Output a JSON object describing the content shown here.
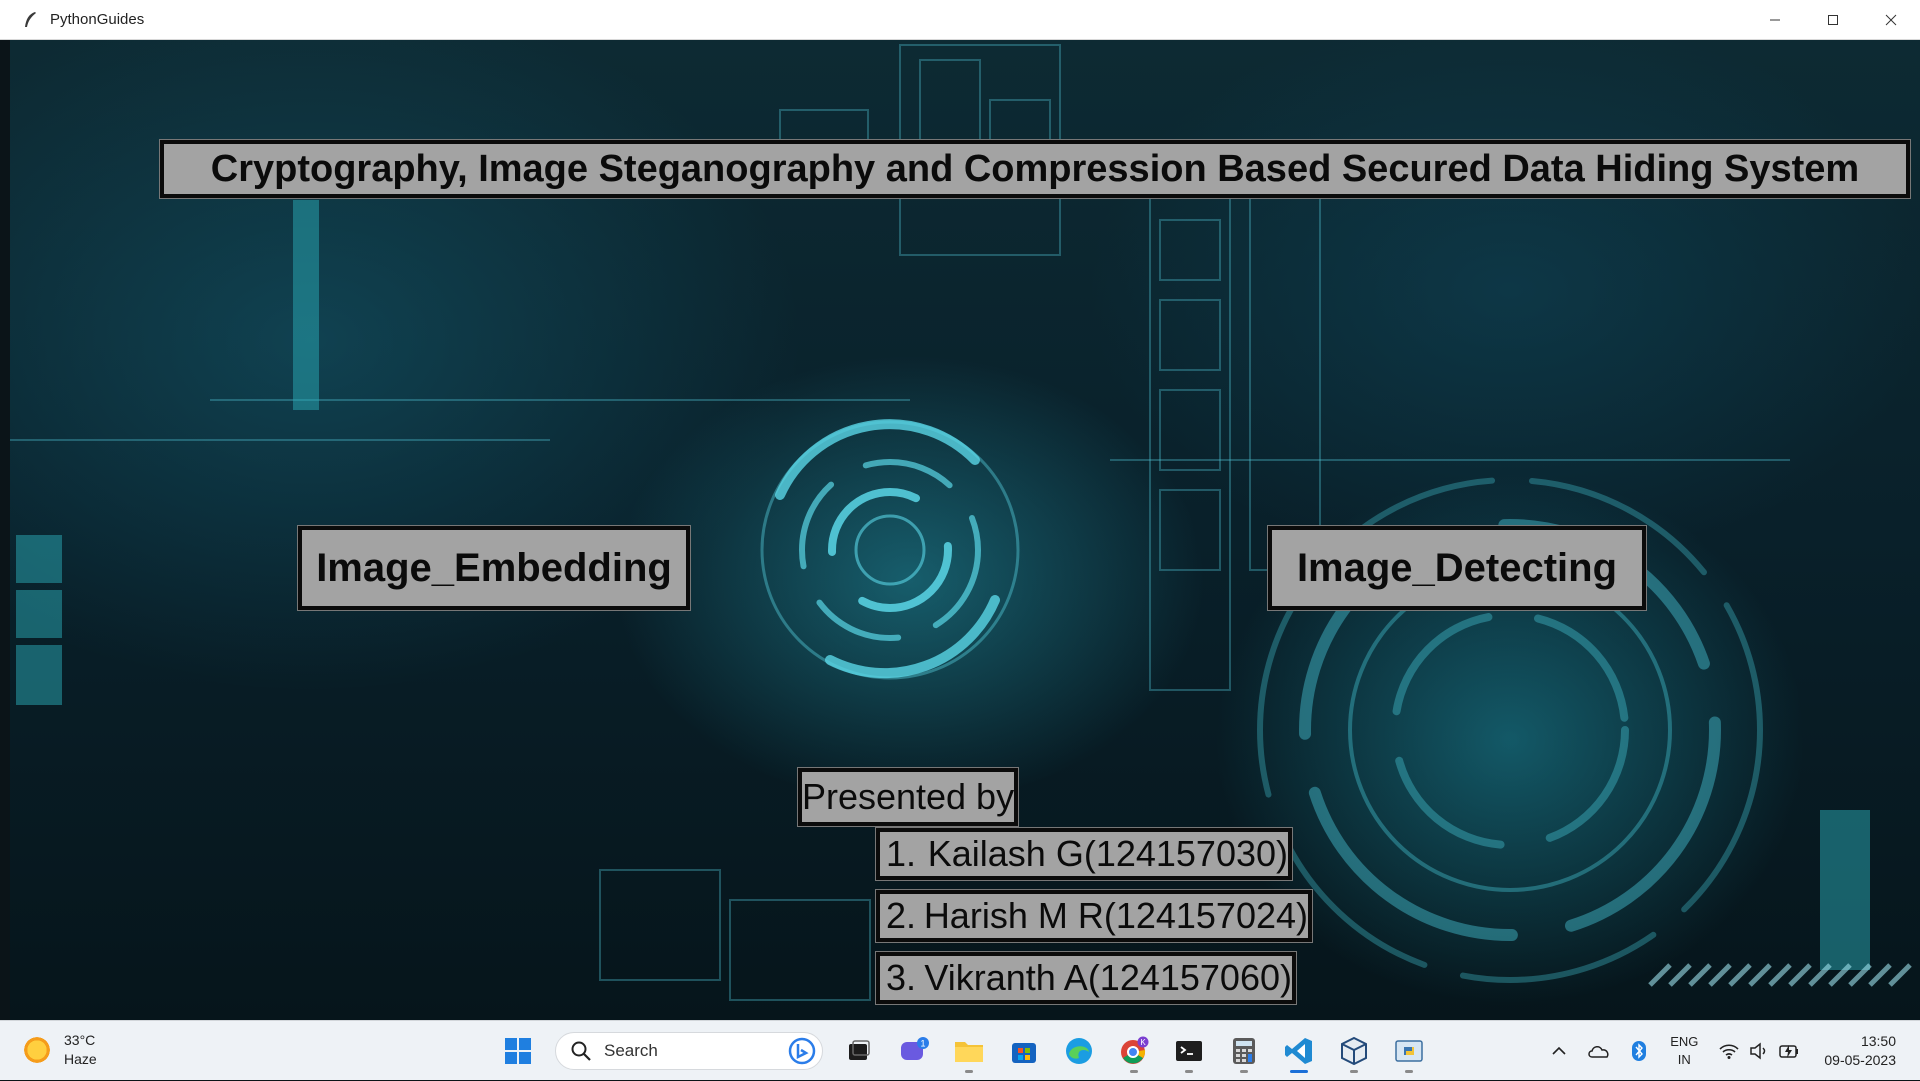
{
  "window": {
    "title": "PythonGuides"
  },
  "app": {
    "title": "Cryptography, Image Steganography and Compression Based Secured Data Hiding System",
    "buttons": {
      "embed": "Image_Embedding",
      "detect": "Image_Detecting"
    },
    "presented_by": "Presented by",
    "members": [
      {
        "num": "1.",
        "name": "Kailash G(124157030)"
      },
      {
        "num": "2.",
        "name": "Harish M R(124157024)"
      },
      {
        "num": "3.",
        "name": "Vikranth A(124157060)"
      }
    ]
  },
  "taskbar": {
    "weather": {
      "temp": "33°C",
      "condition": "Haze"
    },
    "search_placeholder": "Search",
    "chat_badge": "1",
    "chrome_badge": "K",
    "language": {
      "line1": "ENG",
      "line2": "IN"
    },
    "clock": {
      "time": "13:50",
      "date": "09-05-2023"
    },
    "icons": [
      "windows-start-icon",
      "search-icon",
      "bing-icon",
      "task-view-icon",
      "chat-icon",
      "file-explorer-icon",
      "store-icon",
      "edge-icon",
      "chrome-icon",
      "terminal-icon",
      "calculator-icon",
      "vscode-icon",
      "virtualbox-icon",
      "python-icon",
      "chevron-up-icon",
      "onedrive-icon",
      "bluetooth-icon",
      "wifi-icon",
      "volume-icon",
      "battery-icon"
    ]
  },
  "colors": {
    "label_bg": "#a3a3a3",
    "label_border": "#0b0b0b",
    "accent": "#2fb8c8"
  }
}
